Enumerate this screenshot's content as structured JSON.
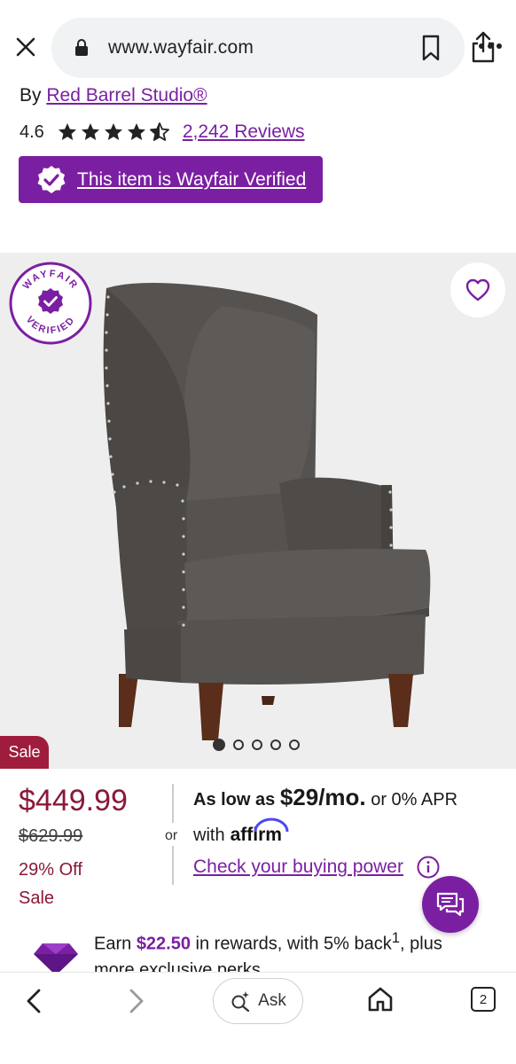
{
  "browser": {
    "url": "www.wayfair.com",
    "tab_count": "2",
    "ask_label": "Ask"
  },
  "product": {
    "by_prefix": "By",
    "brand": "Red Barrel Studio®",
    "rating": "4.6",
    "rating_value": 4.6,
    "rating_max": 5,
    "reviews": "2,242 Reviews",
    "verified_banner": "This item is Wayfair Verified",
    "verified_stamp_text": "WAYFAIR VERIFIED",
    "sale_tag": "Sale",
    "image_carousel": {
      "count": 5,
      "active_index": 0
    }
  },
  "pricing": {
    "price": "$449.99",
    "was_price": "$629.99",
    "percent_off": "29% Off",
    "sale_label": "Sale",
    "or_label": "or",
    "financing": {
      "prefix": "As low as",
      "monthly": "$29/mo.",
      "suffix": "or 0% APR",
      "with_label": "with",
      "provider": "affirm",
      "check_link": "Check your buying power"
    }
  },
  "rewards": {
    "earn": "Earn",
    "amount": "$22.50",
    "middle": "in rewards, with 5% back",
    "sup": "1",
    "tail": ", plus more exclusive perks"
  },
  "colors": {
    "brand_purple": "#7b1fa2",
    "sale_red": "#8a1838",
    "sale_tag_bg": "#a01c3c"
  },
  "icons": {
    "close": "close-icon",
    "lock": "lock-icon",
    "bookmark": "bookmark-icon",
    "share": "share-icon",
    "more": "more-icon",
    "heart": "heart-icon",
    "chat": "chat-icon",
    "info": "info-icon",
    "back": "chevron-left-icon",
    "forward": "chevron-right-icon",
    "ask": "sparkle-search-icon",
    "home": "home-icon",
    "tabs": "tabs-icon"
  }
}
